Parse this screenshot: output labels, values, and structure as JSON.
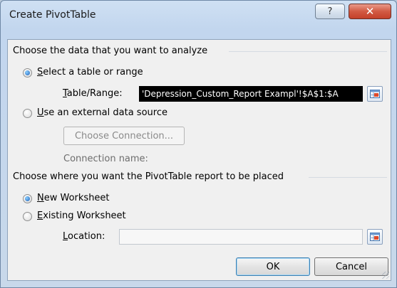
{
  "window": {
    "title": "Create PivotTable",
    "help_glyph": "?",
    "close_glyph": "✕"
  },
  "section1": {
    "heading": "Choose the data that you want to analyze",
    "option_select": {
      "accel": "S",
      "rest": "elect a table or range",
      "checked": true
    },
    "table_range": {
      "label_accel": "T",
      "label_rest": "able/Range:",
      "value": "'Depression_Custom_Report Exampl'!$A$1:$A"
    },
    "option_external": {
      "accel": "U",
      "rest": "se an external data source",
      "checked": false
    },
    "choose_connection_label": "Choose Connection...",
    "connection_name_label": "Connection name:"
  },
  "section2": {
    "heading": "Choose where you want the PivotTable report to be placed",
    "option_new": {
      "accel": "N",
      "rest": "ew Worksheet",
      "checked": true
    },
    "option_existing": {
      "accel": "E",
      "rest": "xisting Worksheet",
      "checked": false
    },
    "location": {
      "label_accel": "L",
      "label_rest": "ocation:",
      "value": ""
    }
  },
  "buttons": {
    "ok": "OK",
    "cancel": "Cancel"
  },
  "colors": {
    "titlebar": "#c2d6ee",
    "close_red": "#c4402a",
    "dialog_bg": "#f0f0f0",
    "selection": "#000000"
  }
}
